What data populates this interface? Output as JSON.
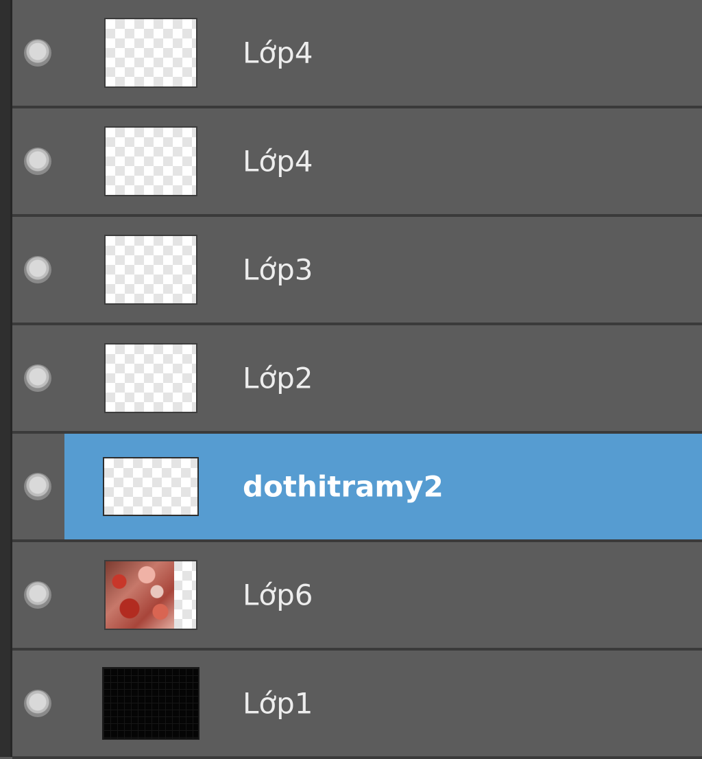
{
  "layers": [
    {
      "name": "Lớp4",
      "thumbnail": "transparent",
      "selected": false
    },
    {
      "name": "Lớp4",
      "thumbnail": "transparent",
      "selected": false
    },
    {
      "name": "Lớp3",
      "thumbnail": "transparent",
      "selected": false
    },
    {
      "name": "Lớp2",
      "thumbnail": "transparent",
      "selected": false
    },
    {
      "name": "dothitramy2",
      "thumbnail": "transparent",
      "selected": true
    },
    {
      "name": "Lớp6",
      "thumbnail": "photo",
      "selected": false
    },
    {
      "name": "Lớp1",
      "thumbnail": "black",
      "selected": false
    }
  ],
  "colors": {
    "panel_bg": "#5c5c5c",
    "selection": "#569cd1",
    "row_divider": "#3a3a3a"
  },
  "icons": {
    "visibility": "visibility-dot-icon"
  }
}
